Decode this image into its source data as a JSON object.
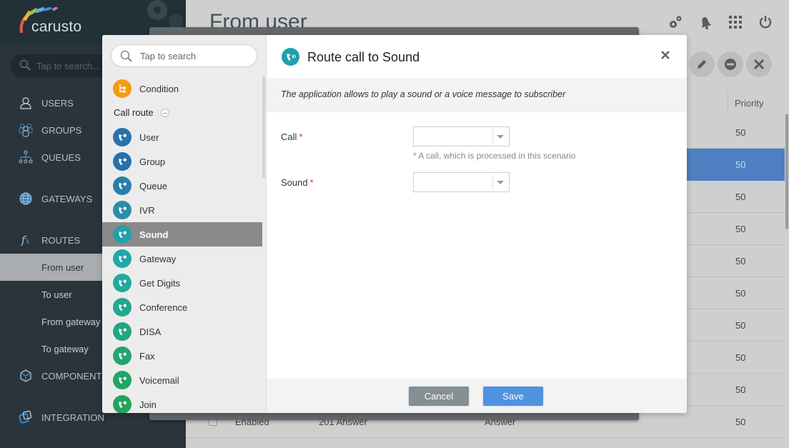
{
  "brand": {
    "name": "carusto"
  },
  "sidebar": {
    "search_placeholder": "Tap to search...",
    "items": [
      {
        "label": "USERS",
        "icon": "user-icon"
      },
      {
        "label": "GROUPS",
        "icon": "group-icon"
      },
      {
        "label": "QUEUES",
        "icon": "queue-icon"
      },
      {
        "label": "GATEWAYS",
        "icon": "globe-icon"
      },
      {
        "label": "ROUTES",
        "icon": "fx-icon"
      },
      {
        "label": "COMPONENTS",
        "icon": "cube-icon"
      },
      {
        "label": "INTEGRATION",
        "icon": "integration-icon"
      }
    ],
    "route_subitems": [
      {
        "label": "From user",
        "active": true
      },
      {
        "label": "To user"
      },
      {
        "label": "From gateway"
      },
      {
        "label": "To gateway"
      }
    ]
  },
  "page": {
    "title": "From user",
    "top_icons": [
      "settings-gears-icon",
      "notification-bell-icon",
      "apps-grid-icon",
      "power-icon"
    ],
    "action_buttons": [
      "edit-icon",
      "disable-icon",
      "delete-icon"
    ],
    "table": {
      "columns": [
        "Priority"
      ],
      "rows": [
        {
          "priority": "50"
        },
        {
          "priority": "50",
          "selected": true
        },
        {
          "priority": "50"
        },
        {
          "priority": "50"
        },
        {
          "priority": "50"
        },
        {
          "priority": "50"
        },
        {
          "priority": "50"
        },
        {
          "priority": "50"
        },
        {
          "priority": "50"
        },
        {
          "status": "Enabled",
          "code": "201 Answer",
          "action": "Answer",
          "priority": "50"
        }
      ]
    }
  },
  "modal": {
    "picker": {
      "search_placeholder": "Tap to search",
      "top_item": {
        "label": "Condition",
        "color": "#f39c12"
      },
      "group_label": "Call route",
      "items": [
        {
          "label": "User",
          "color": "#2872ab"
        },
        {
          "label": "Group",
          "color": "#2772aa"
        },
        {
          "label": "Queue",
          "color": "#2a7fa6"
        },
        {
          "label": "IVR",
          "color": "#2a8ea8"
        },
        {
          "label": "Sound",
          "color": "#23a0aa",
          "active": true
        },
        {
          "label": "Gateway",
          "color": "#21a7a6"
        },
        {
          "label": "Get Digits",
          "color": "#22aa9c"
        },
        {
          "label": "Conference",
          "color": "#22a890"
        },
        {
          "label": "DISA",
          "color": "#22a67f"
        },
        {
          "label": "Fax",
          "color": "#22a571"
        },
        {
          "label": "Voicemail",
          "color": "#22a565"
        },
        {
          "label": "Join",
          "color": "#22a45a"
        }
      ]
    },
    "title": "Route call to Sound",
    "description": "The application allows to play a sound or a voice message to subscriber",
    "fields": [
      {
        "label": "Call",
        "required": "*",
        "value": "",
        "hint": "* A call, which is processed in this scenario"
      },
      {
        "label": "Sound",
        "required": "*",
        "value": ""
      }
    ],
    "buttons": {
      "cancel": "Cancel",
      "save": "Save"
    }
  }
}
